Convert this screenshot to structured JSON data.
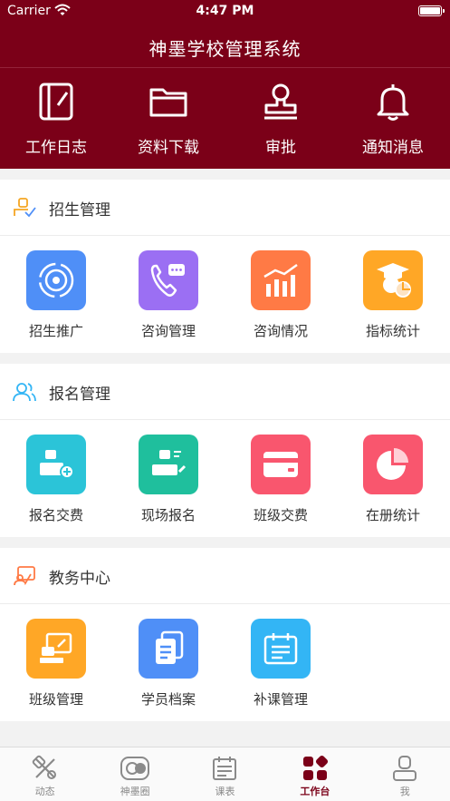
{
  "status_bar": {
    "carrier": "Carrier",
    "time": "4:47 PM"
  },
  "header": {
    "title": "神墨学校管理系统",
    "quick_actions": [
      {
        "label": "工作日志",
        "icon": "notebook-icon"
      },
      {
        "label": "资料下载",
        "icon": "folder-icon"
      },
      {
        "label": "审批",
        "icon": "stamp-icon"
      },
      {
        "label": "通知消息",
        "icon": "bell-icon"
      }
    ]
  },
  "sections": [
    {
      "title": "招生管理",
      "icon": "enrollment-icon",
      "items": [
        {
          "label": "招生推广",
          "icon": "broadcast-icon",
          "color": "#4f8ff7"
        },
        {
          "label": "咨询管理",
          "icon": "phone-chat-icon",
          "color": "#9b6ff3"
        },
        {
          "label": "咨询情况",
          "icon": "bar-chart-icon",
          "color": "#ff7a45"
        },
        {
          "label": "指标统计",
          "icon": "graduate-icon",
          "color": "#ffa726"
        }
      ]
    },
    {
      "title": "报名管理",
      "icon": "users-icon",
      "items": [
        {
          "label": "报名交费",
          "icon": "register-pay-icon",
          "color": "#2bc4d8"
        },
        {
          "label": "现场报名",
          "icon": "onsite-icon",
          "color": "#1fbf9d"
        },
        {
          "label": "班级交费",
          "icon": "card-icon",
          "color": "#f9566e"
        },
        {
          "label": "在册统计",
          "icon": "pie-chart-icon",
          "color": "#f9566e"
        }
      ]
    },
    {
      "title": "教务中心",
      "icon": "teaching-icon",
      "items": [
        {
          "label": "班级管理",
          "icon": "classroom-icon",
          "color": "#ffa726"
        },
        {
          "label": "学员档案",
          "icon": "files-icon",
          "color": "#4f8ff7"
        },
        {
          "label": "补课管理",
          "icon": "calendar-icon",
          "color": "#33b5f5"
        }
      ]
    }
  ],
  "tabbar": [
    {
      "label": "动态",
      "icon": "feed-icon",
      "active": false
    },
    {
      "label": "神墨圈",
      "icon": "circle-icon",
      "active": false
    },
    {
      "label": "课表",
      "icon": "schedule-icon",
      "active": false
    },
    {
      "label": "工作台",
      "icon": "workbench-icon",
      "active": true
    },
    {
      "label": "我",
      "icon": "profile-icon",
      "active": false
    }
  ],
  "colors": {
    "brand": "#7b0018",
    "tab_inactive": "#8a8a8a"
  }
}
